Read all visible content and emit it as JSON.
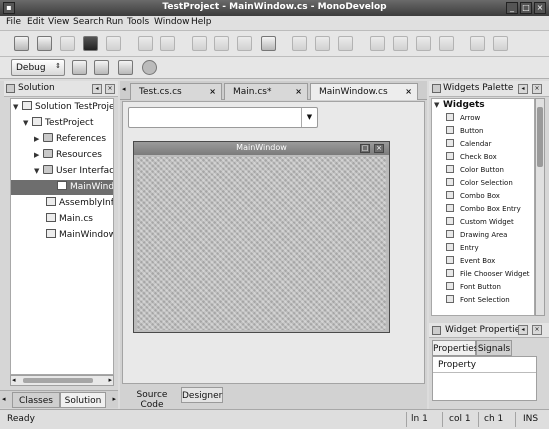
{
  "window": {
    "title": "TestProject - MainWindow.cs - MonoDevelop"
  },
  "menu": [
    "File",
    "Edit",
    "View",
    "Search",
    "Run",
    "Tools",
    "Window",
    "Help"
  ],
  "toolbar": {
    "configuration": "Debug",
    "icons": [
      "new-file-icon",
      "open-icon",
      "save-icon",
      "save-all-icon",
      "print-icon",
      "undo-icon",
      "redo-icon",
      "cut-icon",
      "copy-icon",
      "paste-icon",
      "delete-icon",
      "find-icon",
      "find-replace-icon",
      "goto-icon",
      "build-icon",
      "rebuild-icon",
      "clean-icon",
      "run-icon"
    ]
  },
  "solution_pad": {
    "title": "Solution",
    "tree": [
      {
        "label": "Solution TestProject",
        "depth": 0,
        "expanded": true
      },
      {
        "label": "TestProject",
        "depth": 1,
        "expanded": true
      },
      {
        "label": "References",
        "depth": 2,
        "expanded": false
      },
      {
        "label": "Resources",
        "depth": 2,
        "expanded": false
      },
      {
        "label": "User Interface",
        "depth": 2,
        "expanded": true
      },
      {
        "label": "MainWindow",
        "depth": 3,
        "selected": true
      },
      {
        "label": "AssemblyInfo.cs",
        "depth": 2
      },
      {
        "label": "Main.cs",
        "depth": 2
      },
      {
        "label": "MainWindow.cs",
        "depth": 2
      }
    ],
    "tabs": [
      "Classes",
      "Solution"
    ],
    "active_tab": "Solution"
  },
  "editor": {
    "tabs": [
      {
        "label": "Test.cs.cs",
        "active": false
      },
      {
        "label": "Main.cs*",
        "active": false
      },
      {
        "label": "MainWindow.cs",
        "active": true
      }
    ],
    "designer_window_title": "MainWindow",
    "bottom_tabs": [
      "Source Code",
      "Designer"
    ],
    "active_bottom_tab": "Designer"
  },
  "widgets_palette": {
    "title": "Widgets Palette",
    "group": "Widgets",
    "items": [
      "Arrow",
      "Button",
      "Calendar",
      "Check Box",
      "Color Button",
      "Color Selection",
      "Combo Box",
      "Combo Box Entry",
      "Custom Widget",
      "Drawing Area",
      "Entry",
      "Event Box",
      "File Chooser Widget",
      "Font Button",
      "Font Selection"
    ]
  },
  "widget_properties": {
    "title": "Widget Properties",
    "tabs": [
      "Properties",
      "Signals"
    ],
    "active_tab": "Properties",
    "column_header": "Property"
  },
  "status": {
    "message": "Ready",
    "line": "ln 1",
    "column": "col 1",
    "char": "ch 1",
    "mode": "INS"
  }
}
